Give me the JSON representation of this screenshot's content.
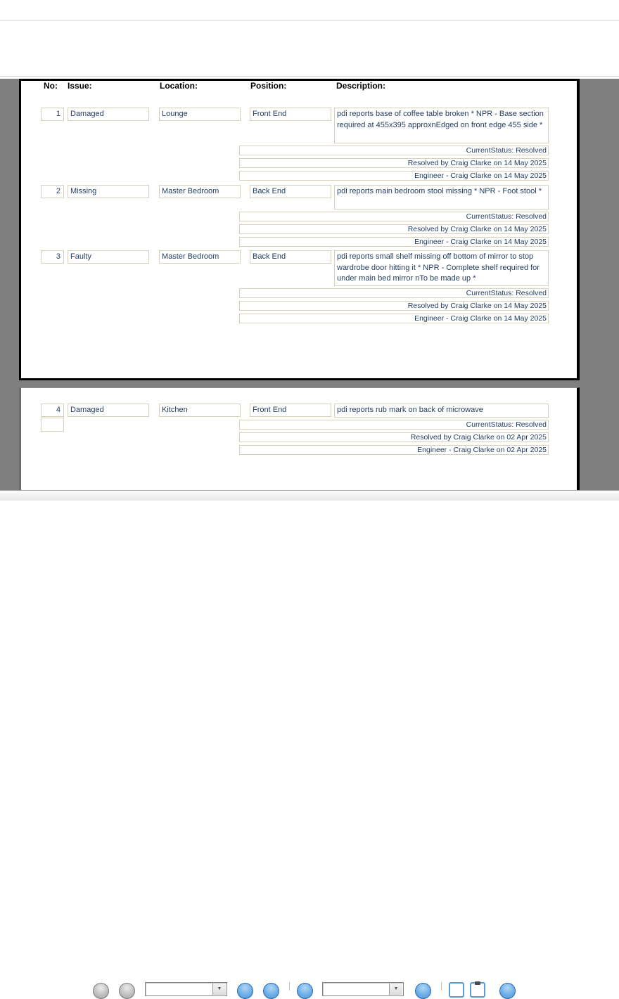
{
  "report": {
    "column_headers": {
      "no": "No:",
      "issue": "Issue:",
      "location": "Location:",
      "position": "Position:",
      "description": "Description:"
    },
    "records": [
      {
        "no": "1",
        "issue": "Damaged",
        "location": "Lounge",
        "position": "Front End",
        "description": "pdi reports base of coffee table broken * NPR - Base section required at 455x395 approxnEdged on front edge 455 side *",
        "status_lines": [
          "CurrentStatus: Resolved",
          "Resolved by Craig Clarke on 14 May 2025",
          "Engineer - Craig Clarke on 14 May 2025"
        ]
      },
      {
        "no": "2",
        "issue": "Missing",
        "location": "Master Bedroom",
        "position": "Back End",
        "description": "pdi reports main bedroom stool missing * NPR - Foot stool *",
        "status_lines": [
          "CurrentStatus: Resolved",
          "Resolved by Craig Clarke on 14 May 2025",
          "Engineer - Craig Clarke on 14 May 2025"
        ]
      },
      {
        "no": "3",
        "issue": "Faulty",
        "location": "Master Bedroom",
        "position": "Back End",
        "description": "pdi reports small shelf missing off bottom of mirror to stop wardrobe door hitting it * NPR - Complete shelf required for under main bed mirror nTo be made up *",
        "status_lines": [
          "CurrentStatus: Resolved",
          "Resolved by Craig Clarke on 14 May 2025",
          "Engineer - Craig Clarke on 14 May 2025"
        ]
      },
      {
        "no": "4",
        "issue": "Damaged",
        "location": "Kitchen",
        "position": "Front End",
        "description": "pdi reports rub mark on back of microwave",
        "status_lines": [
          "CurrentStatus: Resolved",
          "Resolved by Craig Clarke on 02 Apr 2025",
          "Engineer - Craig Clarke on 02 Apr 2025"
        ]
      }
    ]
  },
  "colors": {
    "canvas_gray": "#7f7f7f",
    "field_border": "#d9d2ba",
    "field_text": "#1f3c5f",
    "toolbar_blue": "#3f8fd8",
    "toolbar_gray": "#9d9d9d"
  },
  "toolbar": {
    "combobox1_value": "",
    "combobox2_value": "",
    "button_names": [
      "nav-gray-1",
      "nav-gray-2",
      "record-combobox-1",
      "action-blue-1",
      "action-blue-2",
      "action-blue-3",
      "record-combobox-2",
      "action-blue-4",
      "export-file",
      "clipboard",
      "action-blue-5"
    ]
  }
}
